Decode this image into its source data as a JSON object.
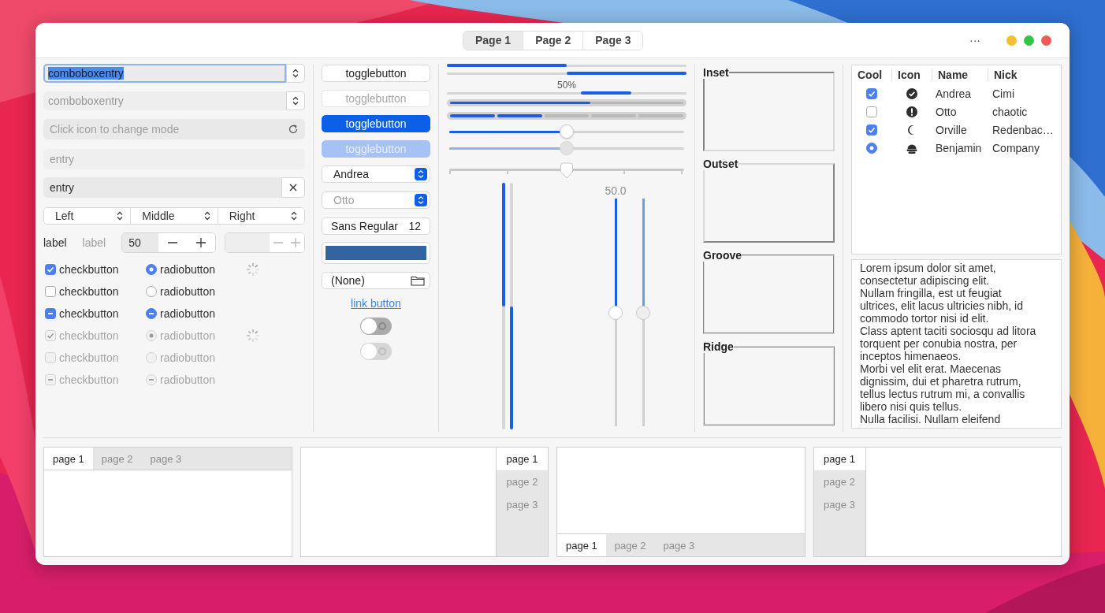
{
  "window": {
    "tabs": [
      {
        "label": "Page 1",
        "selected": true
      },
      {
        "label": "Page 2",
        "selected": false
      },
      {
        "label": "Page 3",
        "selected": false
      }
    ],
    "menu_button": "···"
  },
  "combo_entries": [
    {
      "value": "comboboxentry",
      "text_selected": true,
      "disabled": false
    },
    {
      "value": "comboboxentry",
      "text_selected": false,
      "disabled": true
    }
  ],
  "mode_entry": {
    "placeholder": "Click icon to change mode"
  },
  "entries": [
    {
      "value": "entry",
      "disabled": true,
      "clear_button": false
    },
    {
      "value": "entry",
      "disabled": false,
      "clear_button": true
    }
  ],
  "combo_row": [
    "Left",
    "Middle",
    "Right"
  ],
  "labels": [
    {
      "text": "label",
      "disabled": false
    },
    {
      "text": "label",
      "disabled": true
    }
  ],
  "spin_buttons": [
    {
      "value": "50",
      "disabled": false
    },
    {
      "disabled": true
    }
  ],
  "check_rows": [
    {
      "check": {
        "label": "checkbutton",
        "checked": true,
        "inconsistent": false,
        "disabled": false
      },
      "radio": {
        "label": "radiobutton",
        "checked": true,
        "inconsistent": false,
        "disabled": false
      },
      "spinner": true
    },
    {
      "check": {
        "label": "checkbutton",
        "checked": false,
        "inconsistent": false,
        "disabled": false
      },
      "radio": {
        "label": "radiobutton",
        "checked": false,
        "inconsistent": false,
        "disabled": false
      },
      "spinner": false
    },
    {
      "check": {
        "label": "checkbutton",
        "checked": false,
        "inconsistent": true,
        "disabled": false
      },
      "radio": {
        "label": "radiobutton",
        "checked": false,
        "inconsistent": true,
        "disabled": false
      },
      "spinner": false
    },
    {
      "check": {
        "label": "checkbutton",
        "checked": true,
        "inconsistent": false,
        "disabled": true
      },
      "radio": {
        "label": "radiobutton",
        "checked": true,
        "inconsistent": false,
        "disabled": true
      },
      "spinner": true
    },
    {
      "check": {
        "label": "checkbutton",
        "checked": false,
        "inconsistent": false,
        "disabled": true
      },
      "radio": {
        "label": "radiobutton",
        "checked": false,
        "inconsistent": false,
        "disabled": true
      },
      "spinner": false
    },
    {
      "check": {
        "label": "checkbutton",
        "checked": false,
        "inconsistent": true,
        "disabled": true
      },
      "radio": {
        "label": "radiobutton",
        "checked": false,
        "inconsistent": true,
        "disabled": true
      },
      "spinner": false
    }
  ],
  "toggle_buttons": [
    {
      "label": "togglebutton",
      "active": false,
      "disabled": false
    },
    {
      "label": "togglebutton",
      "active": false,
      "disabled": true
    },
    {
      "label": "togglebutton",
      "active": true,
      "disabled": false
    },
    {
      "label": "togglebutton",
      "active": true,
      "disabled": true
    }
  ],
  "combos": [
    {
      "value": "Andrea",
      "disabled": false
    },
    {
      "value": "Otto",
      "disabled": true
    }
  ],
  "font_button": {
    "family": "Sans Regular",
    "size": "12"
  },
  "color_button": {
    "color": "#33649f"
  },
  "file_button": {
    "value": "(None)"
  },
  "link_button": "link button",
  "switches": [
    {
      "on": false,
      "disabled": false
    },
    {
      "on": false,
      "disabled": true
    }
  ],
  "progress_bars": [
    {
      "kind": "bar",
      "level": 0.5,
      "inverted": false
    },
    {
      "kind": "bar",
      "level": 0.5,
      "inverted": true
    },
    {
      "kind": "activity",
      "text": "50%"
    },
    {
      "kind": "level",
      "level": 0.6
    },
    {
      "kind": "segments",
      "level": 0.4
    }
  ],
  "sliders": [
    {
      "kind": "round",
      "level": 0.5,
      "disabled": false
    },
    {
      "kind": "round",
      "level": 0.5,
      "disabled": true
    },
    {
      "kind": "marks",
      "level": 0.5,
      "disabled": false
    }
  ],
  "vertical": [
    {
      "kind": "progress",
      "level": 0.5,
      "inverted": false
    },
    {
      "kind": "progress",
      "level": 0.5,
      "inverted": true
    },
    {
      "kind": "scale",
      "level": 0.5,
      "value": "50.0",
      "disabled": false
    },
    {
      "kind": "scale",
      "level": 0.5,
      "disabled": true
    }
  ],
  "frames": [
    {
      "label": "Inset",
      "kind": "inset"
    },
    {
      "label": "Outset",
      "kind": "outset"
    },
    {
      "label": "Groove",
      "kind": "groove"
    },
    {
      "label": "Ridge",
      "kind": "ridge"
    }
  ],
  "tree": {
    "columns": [
      "Cool",
      "Icon",
      "Name",
      "Nick"
    ],
    "rows": [
      {
        "cool": {
          "kind": "check",
          "checked": true
        },
        "name": "Andrea",
        "nick": "Cimi"
      },
      {
        "cool": {
          "kind": "check",
          "checked": false
        },
        "name": "Otto",
        "nick": "chaotic"
      },
      {
        "cool": {
          "kind": "check",
          "checked": true
        },
        "name": "Orville",
        "nick": "Redenbac…"
      },
      {
        "cool": {
          "kind": "radio",
          "checked": true
        },
        "name": "Benjamin",
        "nick": "Company"
      }
    ]
  },
  "text_view": {
    "paragraphs": [
      "Lorem ipsum dolor sit amet, consectetur adipiscing elit.",
      "Nullam fringilla, est ut feugiat ultrices, elit lacus ultricies nibh, id commodo tortor nisi id elit.",
      "Class aptent taciti sociosqu ad litora torquent per conubia nostra, per inceptos himenaeos.",
      "Morbi vel elit erat. Maecenas dignissim, dui et pharetra rutrum, tellus lectus rutrum mi, a convallis libero nisi quis tellus.",
      "Nulla facilisi. Nullam eleifend"
    ]
  },
  "notebooks": [
    {
      "kind": "top",
      "tabs": [
        {
          "label": "page 1",
          "selected": true
        },
        {
          "label": "page 2",
          "selected": false
        },
        {
          "label": "page 3",
          "selected": false
        }
      ]
    },
    {
      "kind": "right",
      "tabs": [
        {
          "label": "page 1",
          "selected": true
        },
        {
          "label": "page 2",
          "selected": false
        },
        {
          "label": "page 3",
          "selected": false
        }
      ]
    },
    {
      "kind": "bottom",
      "tabs": [
        {
          "label": "page 1",
          "selected": true
        },
        {
          "label": "page 2",
          "selected": false
        },
        {
          "label": "page 3",
          "selected": false
        }
      ]
    },
    {
      "kind": "left",
      "tabs": [
        {
          "label": "page 1",
          "selected": true
        },
        {
          "label": "page 2",
          "selected": false
        },
        {
          "label": "page 3",
          "selected": false
        }
      ]
    }
  ]
}
